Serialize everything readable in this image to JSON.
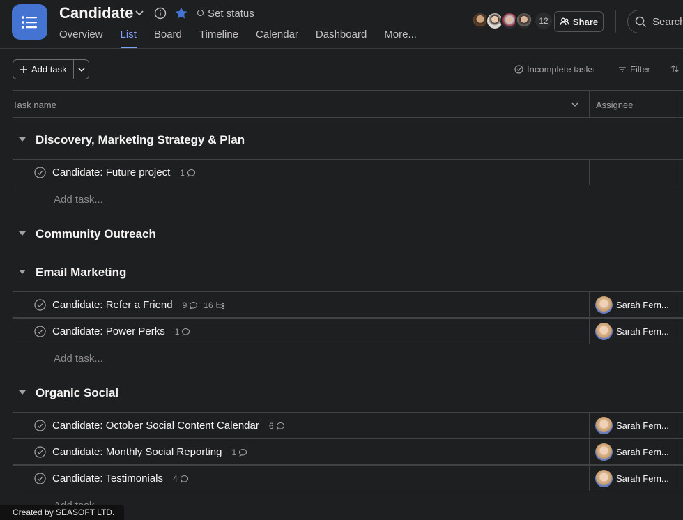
{
  "header": {
    "title": "Candidate",
    "set_status": "Set status",
    "tabs": [
      {
        "label": "Overview"
      },
      {
        "label": "List"
      },
      {
        "label": "Board"
      },
      {
        "label": "Timeline"
      },
      {
        "label": "Calendar"
      },
      {
        "label": "Dashboard"
      },
      {
        "label": "More..."
      }
    ],
    "active_tab": "List",
    "member_count": "12",
    "share_label": "Share",
    "search_label": "Search"
  },
  "toolbar": {
    "add_task_label": "Add task",
    "incomplete_label": "Incomplete tasks",
    "filter_label": "Filter"
  },
  "columns": {
    "task_name": "Task name",
    "assignee": "Assignee"
  },
  "sections": [
    {
      "title": "Discovery, Marketing Strategy & Plan",
      "tasks": [
        {
          "name": "Candidate: Future project",
          "comments": "1",
          "subtasks": null,
          "assignee": ""
        }
      ],
      "add_task": "Add task..."
    },
    {
      "title": "Community Outreach",
      "tasks": []
    },
    {
      "title": "Email Marketing",
      "tasks": [
        {
          "name": "Candidate: Refer a Friend",
          "comments": "9",
          "subtasks": "16",
          "assignee": "Sarah Fern..."
        },
        {
          "name": "Candidate: Power Perks",
          "comments": "1",
          "subtasks": null,
          "assignee": "Sarah Fern..."
        }
      ],
      "add_task": "Add task..."
    },
    {
      "title": "Organic Social",
      "tasks": [
        {
          "name": "Candidate: October Social Content Calendar",
          "comments": "6",
          "subtasks": null,
          "assignee": "Sarah Fern..."
        },
        {
          "name": "Candidate: Monthly Social Reporting",
          "comments": "1",
          "subtasks": null,
          "assignee": "Sarah Fern..."
        },
        {
          "name": "Candidate: Testimonials",
          "comments": "4",
          "subtasks": null,
          "assignee": "Sarah Fern..."
        }
      ],
      "add_task": "Add task..."
    }
  ],
  "footer": {
    "text": "Created by SEASOFT LTD."
  },
  "colors": {
    "accent": "#4573d2",
    "active_tab": "#7da3f5",
    "star": "#4573d2",
    "background": "#1e1f21"
  }
}
